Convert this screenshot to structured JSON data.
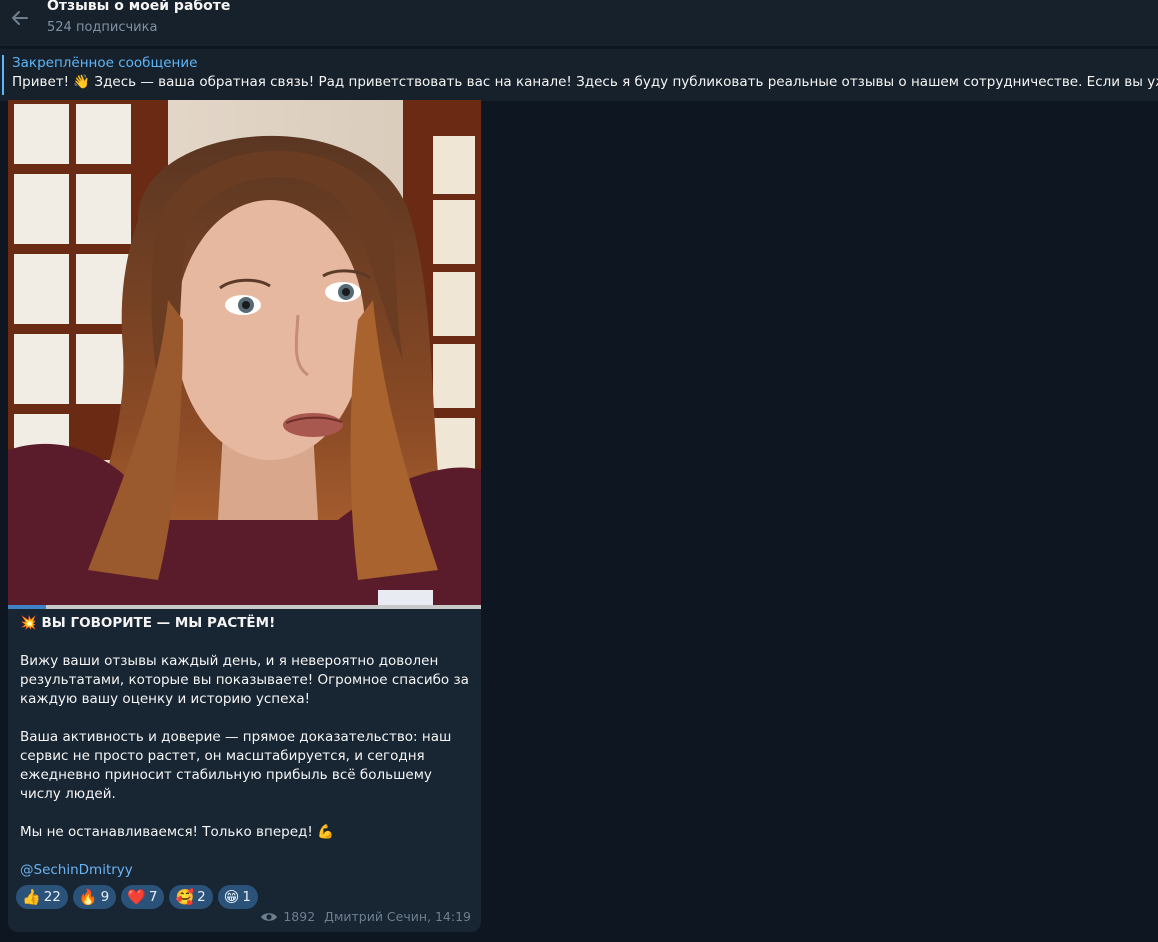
{
  "header": {
    "title": "Отзывы о моей работе",
    "subtitle": "524 подписчика"
  },
  "pinned": {
    "label": "Закреплённое сообщение",
    "text": "Привет! 👋 Здесь — ваша обратная связь!  Рад приветствовать вас на канале! Здесь я буду публиковать реальные отзывы о нашем сотрудничестве.  Если вы уже с"
  },
  "post": {
    "video_progress": 0.08,
    "headline": "💥 ВЫ ГОВОРИТЕ — МЫ РАСТЁМ!",
    "paragraph1": "Вижу ваши отзывы каждый день, и я невероятно доволен результатами, которые вы показываете! Огромное спасибо за каждую вашу оценку и историю успеха!",
    "paragraph2": "Ваша активность и доверие — прямое доказательство: наш сервис не просто растет, он масштабируется, и сегодня ежедневно приносит стабильную прибыль всё большему числу людей.",
    "paragraph3": "Мы не останавливаемся! Только вперед! 💪",
    "mention": "@SechinDmitryy",
    "reactions": [
      {
        "emoji": "👍",
        "count": "22"
      },
      {
        "emoji": "🔥",
        "count": "9"
      },
      {
        "emoji": "❤️",
        "count": "7"
      },
      {
        "emoji": "🥰",
        "count": "2"
      },
      {
        "emoji": "😁",
        "count": "1"
      }
    ],
    "views": "1892",
    "author_time": "Дмитрий Сечин, 14:19"
  },
  "colors": {
    "background": "#0e1621",
    "panel": "#17212b",
    "bubble": "#182533",
    "accent": "#5eb5f7",
    "reaction_bg": "#2b5278"
  }
}
